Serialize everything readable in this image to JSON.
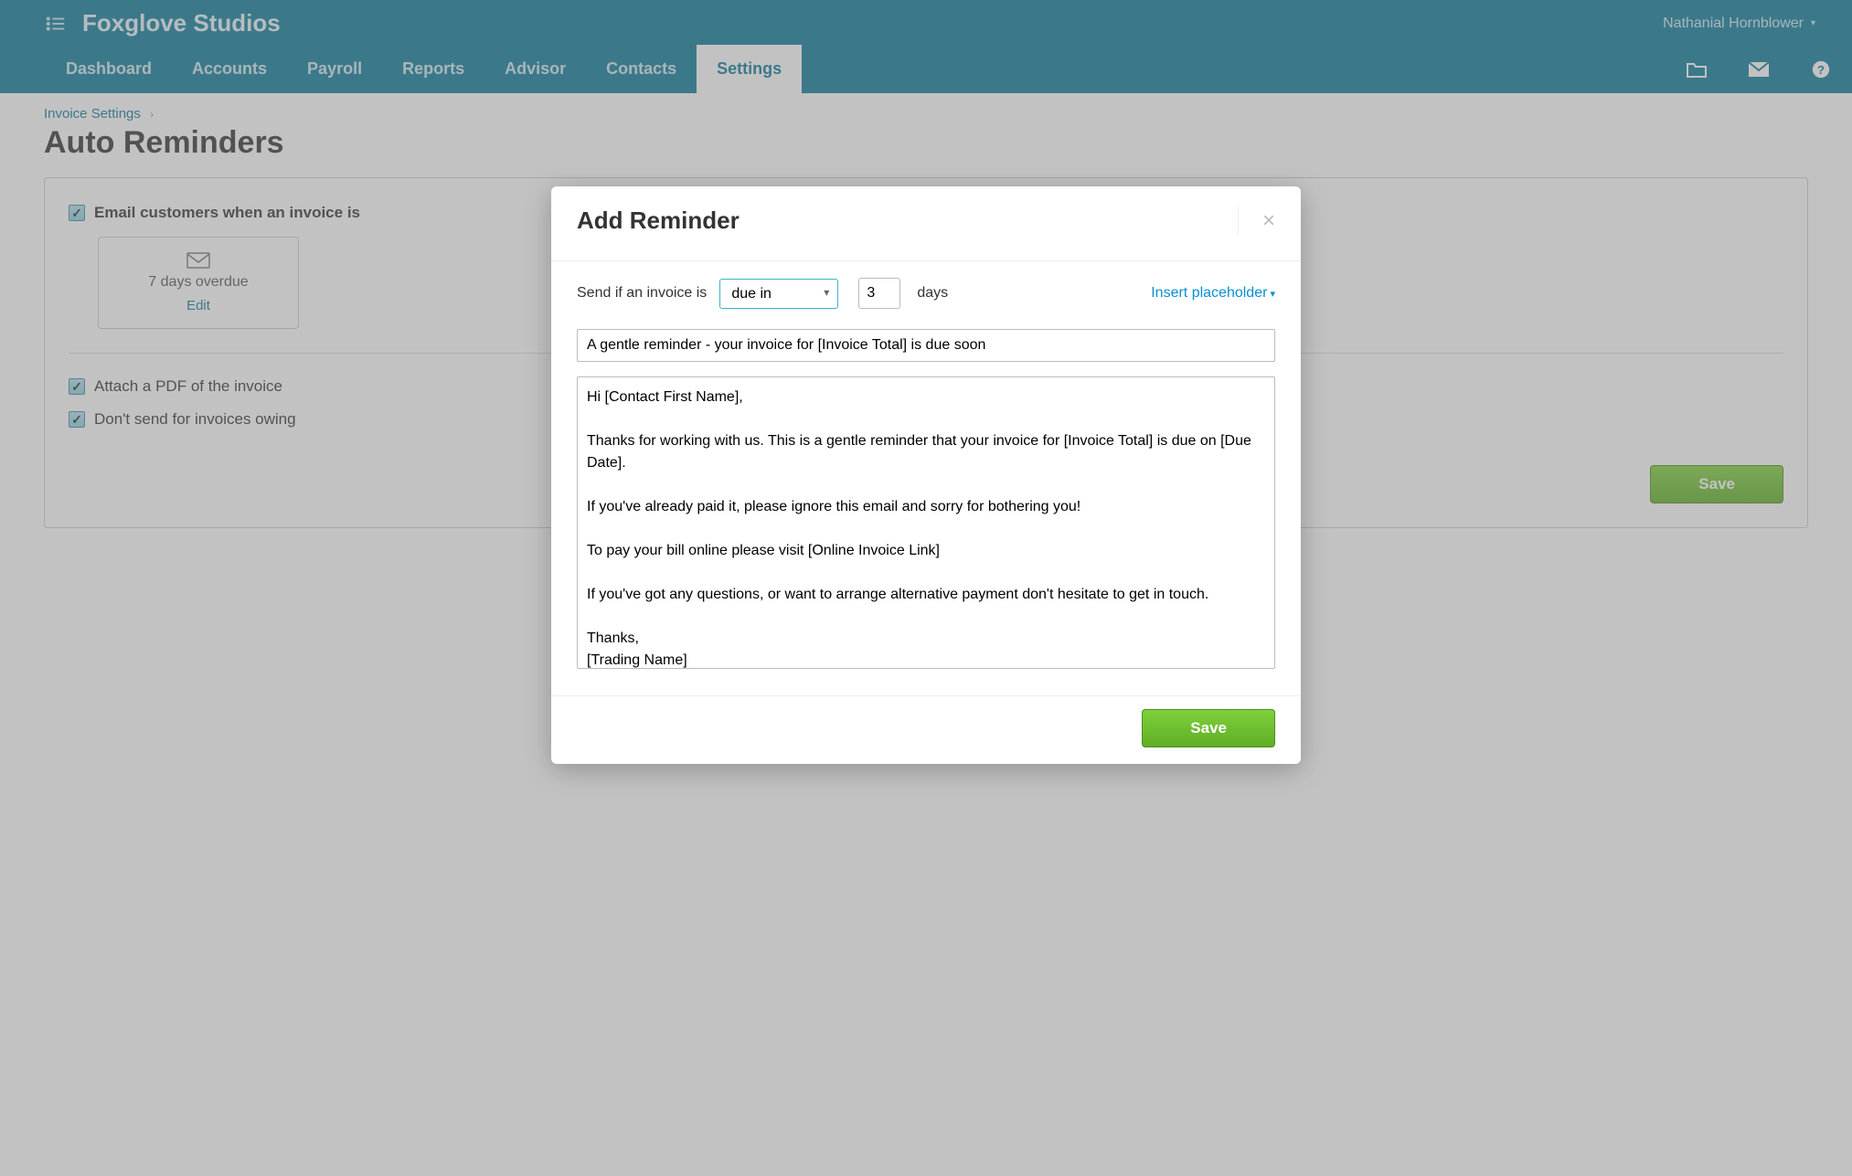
{
  "header": {
    "org_name": "Foxglove Studios",
    "user_name": "Nathanial Hornblower"
  },
  "nav": {
    "items": [
      "Dashboard",
      "Accounts",
      "Payroll",
      "Reports",
      "Advisor",
      "Contacts",
      "Settings"
    ],
    "active_index": 6
  },
  "breadcrumb": {
    "parent": "Invoice Settings"
  },
  "page": {
    "title": "Auto Reminders"
  },
  "panel": {
    "email_customers_label": "Email customers when an invoice is",
    "reminder_card": {
      "label": "7 days overdue",
      "edit": "Edit"
    },
    "attach_pdf_label": "Attach a PDF of the invoice",
    "dont_send_label": "Don't send for invoices owing",
    "save": "Save"
  },
  "modal": {
    "title": "Add Reminder",
    "send_if_label": "Send if an invoice is",
    "due_select": "due in",
    "days_value": "3",
    "days_label": "days",
    "insert_placeholder": "Insert placeholder",
    "subject": "A gentle reminder - your invoice for [Invoice Total] is due soon",
    "body": "Hi [Contact First Name],\n\nThanks for working with us. This is a gentle reminder that your invoice for [Invoice Total] is due on [Due Date].\n\nIf you've already paid it, please ignore this email and sorry for bothering you!\n\nTo pay your bill online please visit [Online Invoice Link]\n\nIf you've got any questions, or want to arrange alternative payment don't hesitate to get in touch.\n\nThanks,\n[Trading Name]",
    "save": "Save"
  }
}
